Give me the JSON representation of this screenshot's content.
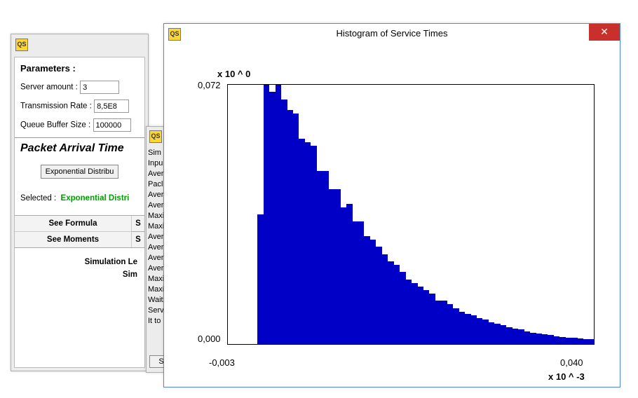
{
  "app_logo_text": "QS",
  "params_window": {
    "title": "Parameters :",
    "server_amount_label": "Server amount :",
    "server_amount_value": "3",
    "transmission_rate_label": "Transmission Rate :",
    "transmission_rate_value": "8,5E8",
    "queue_buffer_label": "Queue Buffer Size :",
    "queue_buffer_value": "100000",
    "section2_title": "Packet Arrival Time",
    "dist_button": "Exponential Distribu",
    "selected_label": "Selected :",
    "selected_value": "Exponential Distri",
    "see_formula": "See Formula",
    "see_moments": "See Moments",
    "s_top": "S",
    "s_bot": "S",
    "sim_len_label": "Simulation Le",
    "sim_label": "Sim"
  },
  "middle_window": {
    "lines": [
      "Sim",
      "Inpu",
      "Aver",
      "Pacl",
      "Aver",
      "Aver",
      "Maxi",
      "Maxi",
      "Aver",
      "Aver",
      "Aver",
      "Aver",
      "Maxi",
      "Maxi",
      "Wait",
      "Serv",
      "It to"
    ],
    "s_btn": "S"
  },
  "hist_window": {
    "title": "Histogram of Service Times",
    "y_scale_hint": "x 10 ^ 0",
    "y_max": "0,072",
    "y_min": "0,000",
    "x_min": "-0,003",
    "x_max": "0,040",
    "x_scale_hint": "x 10 ^ -3"
  },
  "chart_data": {
    "type": "bar",
    "title": "Histogram of Service Times",
    "xlabel": "",
    "ylabel": "",
    "ylim": [
      0,
      0.072
    ],
    "xlim": [
      -0.003,
      0.04
    ],
    "y_scale": "x 10 ^ 0",
    "x_scale": "x 10 ^ -3",
    "categories": [
      -0.0024,
      -0.0018,
      -0.0012,
      -0.0006,
      0.0,
      0.0006,
      0.0012,
      0.0018,
      0.0024,
      0.003,
      0.0036,
      0.0042,
      0.0048,
      0.0054,
      0.006,
      0.0066,
      0.0072,
      0.0078,
      0.0084,
      0.009,
      0.0096,
      0.0102,
      0.0108,
      0.0114,
      0.012,
      0.0126,
      0.0132,
      0.0138,
      0.0144,
      0.015,
      0.0156,
      0.0162,
      0.0168,
      0.0174,
      0.018,
      0.0186,
      0.0192,
      0.0198,
      0.0204,
      0.021,
      0.0216,
      0.0222,
      0.0228,
      0.0234,
      0.024,
      0.0246,
      0.0252,
      0.0258,
      0.0264,
      0.027,
      0.0276,
      0.0282,
      0.0288,
      0.0294,
      0.03,
      0.0306,
      0.0312,
      0.0318,
      0.0324,
      0.033,
      0.0336,
      0.0342,
      0.0348,
      0.0354,
      0.036,
      0.0366,
      0.0372,
      0.0378,
      0.0384,
      0.039
    ],
    "values": [
      0.0,
      0.0,
      0.0,
      0.0,
      0.0,
      0.036,
      0.072,
      0.07,
      0.072,
      0.068,
      0.065,
      0.064,
      0.057,
      0.056,
      0.055,
      0.048,
      0.048,
      0.043,
      0.043,
      0.038,
      0.039,
      0.034,
      0.034,
      0.03,
      0.029,
      0.027,
      0.025,
      0.023,
      0.022,
      0.02,
      0.018,
      0.017,
      0.016,
      0.015,
      0.014,
      0.012,
      0.012,
      0.011,
      0.01,
      0.009,
      0.0083,
      0.008,
      0.0072,
      0.0068,
      0.006,
      0.0056,
      0.0052,
      0.0047,
      0.0043,
      0.004,
      0.0036,
      0.0032,
      0.0029,
      0.0027,
      0.0025,
      0.0022,
      0.002,
      0.0018,
      0.0017,
      0.0016,
      0.0014,
      0.0013,
      0.0011,
      0.001,
      0.0009,
      0.0008,
      0.0007,
      0.0006,
      0.0005,
      0.0005
    ]
  }
}
